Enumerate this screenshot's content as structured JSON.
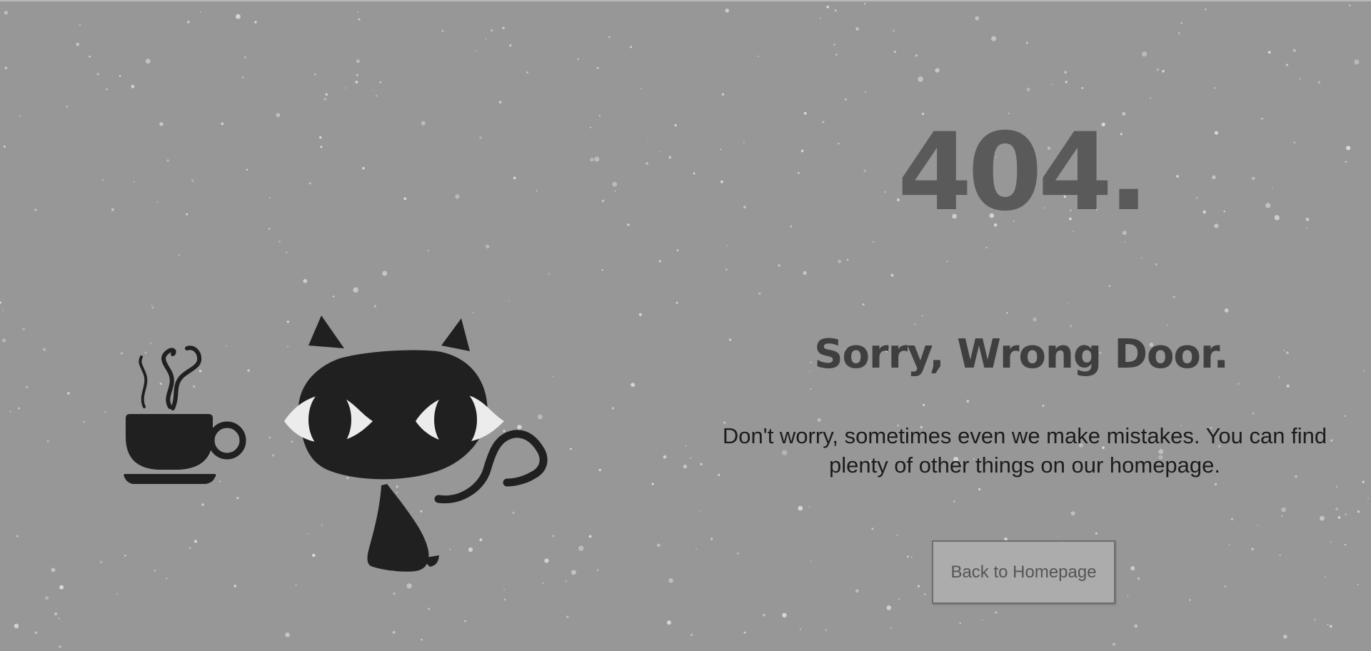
{
  "error_code": "404.",
  "headline": "Sorry, Wrong Door.",
  "message": "Don't worry, sometimes even we make mistakes. You can find plenty of other things on our homepage.",
  "home_button_label": "Back to Homepage",
  "illustration": {
    "cat_icon": "black-cat-icon",
    "cup_icon": "coffee-cup-icon"
  },
  "colors": {
    "background": "#979797",
    "error_code": "#5a5a5a",
    "headline": "#3f3f3f",
    "body_text": "#1c1c1c",
    "button_bg": "#acacac",
    "button_border": "#6e6e6e",
    "illustration": "#202020",
    "snow": "#e6e6e6"
  }
}
